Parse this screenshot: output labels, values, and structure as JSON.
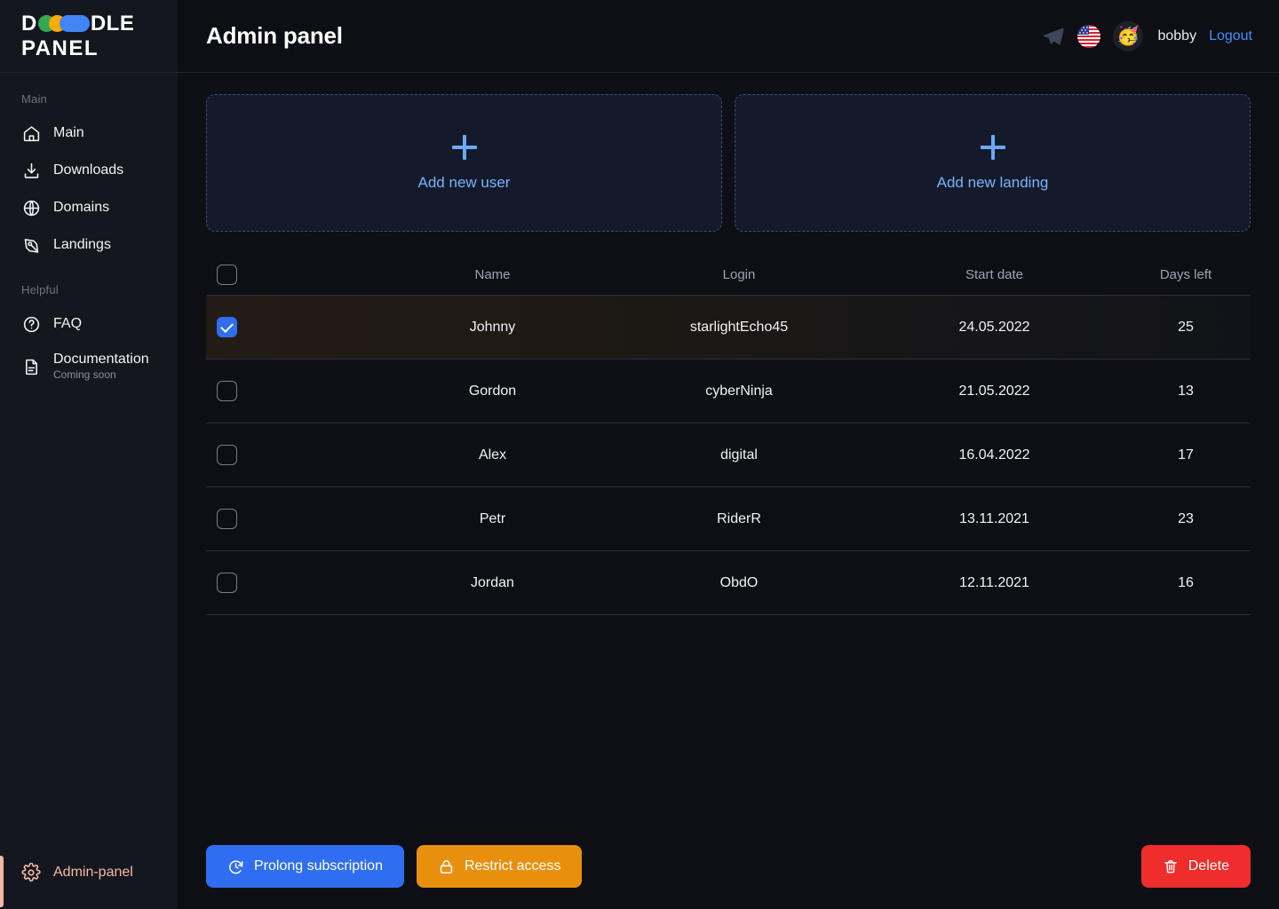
{
  "brand": {
    "name_line1": "DOODLE",
    "name_line1_prefix": "D",
    "name_line1_suffix": "DLE",
    "name_line2": "PANEL",
    "dot_colors": [
      "#34a853",
      "#f9ab00",
      "#4285f4"
    ]
  },
  "sidebar": {
    "sections": [
      {
        "label": "Main",
        "items": [
          {
            "label": "Main",
            "icon": "home-icon",
            "sub": ""
          },
          {
            "label": "Downloads",
            "icon": "download-icon",
            "sub": ""
          },
          {
            "label": "Domains",
            "icon": "globe-icon",
            "sub": ""
          },
          {
            "label": "Landings",
            "icon": "pen-nib-icon",
            "sub": ""
          }
        ]
      },
      {
        "label": "Helpful",
        "items": [
          {
            "label": "FAQ",
            "icon": "question-circle-icon",
            "sub": ""
          },
          {
            "label": "Documentation",
            "icon": "document-icon",
            "sub": "Coming soon"
          }
        ]
      }
    ],
    "bottom_item": {
      "label": "Admin-panel",
      "icon": "gear-icon",
      "active": true,
      "accent_color": "#f6b8a6"
    }
  },
  "header": {
    "title": "Admin panel",
    "telegram_icon": "telegram-icon",
    "language_flag": "us-flag-icon",
    "avatar_emoji": "🥳",
    "username": "bobby",
    "logout_label": "Logout",
    "logout_color": "#4a8dfb"
  },
  "cards": [
    {
      "label": "Add new user",
      "icon": "plus-icon"
    },
    {
      "label": "Add new landing",
      "icon": "plus-icon"
    }
  ],
  "table": {
    "columns": [
      "Name",
      "Login",
      "Start date",
      "Days left"
    ],
    "rows": [
      {
        "selected": true,
        "name": "Johnny",
        "login": "starlightEcho45",
        "start_date": "24.05.2022",
        "days_left": "25"
      },
      {
        "selected": false,
        "name": "Gordon",
        "login": "cyberNinja",
        "start_date": "21.05.2022",
        "days_left": "13"
      },
      {
        "selected": false,
        "name": "Alex",
        "login": "digital",
        "start_date": "16.04.2022",
        "days_left": "17"
      },
      {
        "selected": false,
        "name": "Petr",
        "login": "RiderR",
        "start_date": "13.11.2021",
        "days_left": "23"
      },
      {
        "selected": false,
        "name": "Jordan",
        "login": "ObdO",
        "start_date": "12.11.2021",
        "days_left": "16"
      }
    ]
  },
  "footer": {
    "prolong_label": "Prolong subscription",
    "prolong_icon": "clock-refresh-icon",
    "prolong_color": "#2f6ef0",
    "restrict_label": "Restrict access",
    "restrict_icon": "lock-icon",
    "restrict_color": "#e8900d",
    "delete_label": "Delete",
    "delete_icon": "trash-icon",
    "delete_color": "#ef2d2d"
  }
}
